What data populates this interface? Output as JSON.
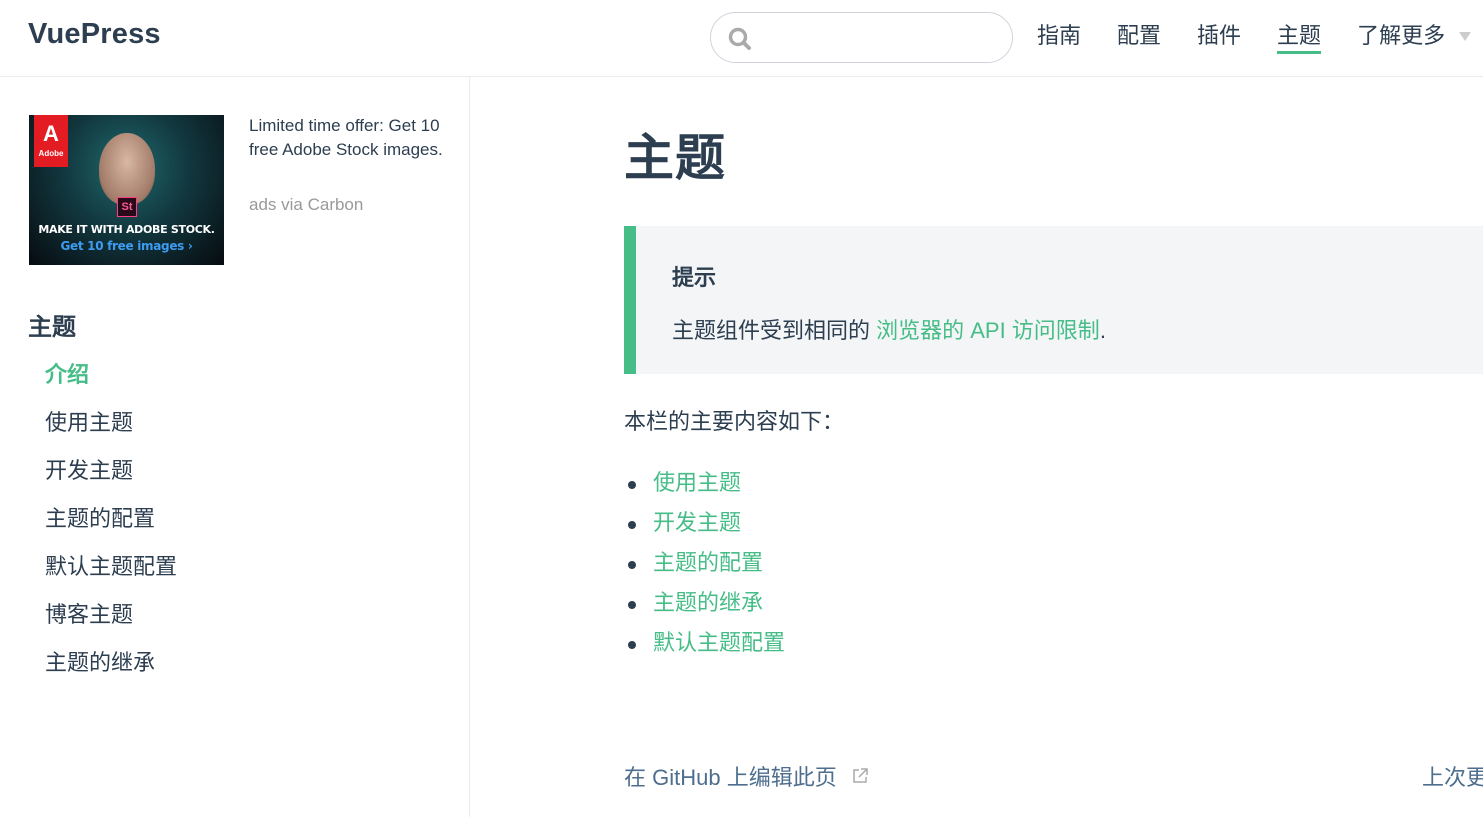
{
  "navbar": {
    "site_name": "VuePress",
    "search": {
      "value": "",
      "placeholder": ""
    },
    "links": [
      {
        "label": "指南",
        "active": false
      },
      {
        "label": "配置",
        "active": false
      },
      {
        "label": "插件",
        "active": false
      },
      {
        "label": "主题",
        "active": true
      },
      {
        "label": "了解更多",
        "active": false,
        "dropdown": true
      }
    ]
  },
  "sidebar": {
    "ad": {
      "brand": "Adobe",
      "product_badge": "St",
      "image_tagline": "MAKE IT WITH ADOBE STOCK.",
      "image_cta": "Get 10 free images ›",
      "text": "Limited time offer: Get 10 free Adobe Stock images.",
      "via": "ads via Carbon"
    },
    "heading": "主题",
    "items": [
      {
        "label": "介绍",
        "active": true
      },
      {
        "label": "使用主题",
        "active": false
      },
      {
        "label": "开发主题",
        "active": false
      },
      {
        "label": "主题的配置",
        "active": false
      },
      {
        "label": "默认主题配置",
        "active": false
      },
      {
        "label": "博客主题",
        "active": false
      },
      {
        "label": "主题的继承",
        "active": false
      }
    ]
  },
  "main": {
    "title": "主题",
    "tip": {
      "title": "提示",
      "text_before": "主题组件受到相同的 ",
      "link": "浏览器的 API 访问限制",
      "text_after": "."
    },
    "intro": "本栏的主要内容如下：",
    "toc": [
      "使用主题",
      "开发主题",
      "主题的配置",
      "主题的继承",
      "默认主题配置"
    ],
    "edit_link": "在 GitHub 上编辑此页",
    "last_updated_label": "上次更"
  },
  "colors": {
    "accent": "#46bd87",
    "text": "#2c3e50",
    "tip_bg": "#f3f5f7",
    "muted": "#999999",
    "footer_link": "#4e6e8e"
  }
}
